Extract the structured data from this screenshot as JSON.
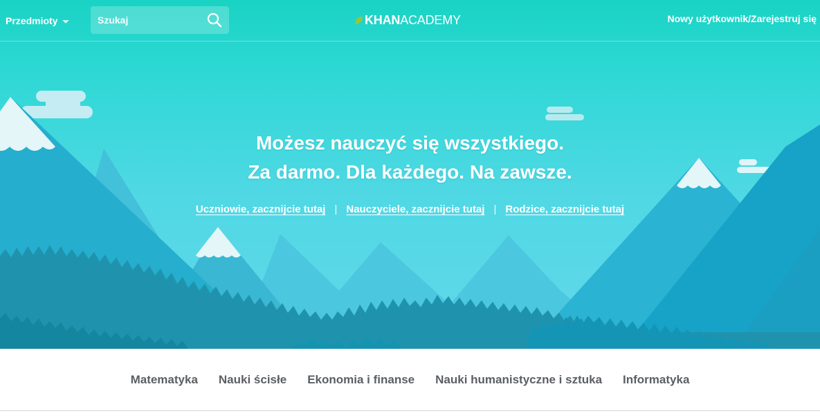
{
  "colors": {
    "hero_top": "#19d3c3",
    "hero_bottom": "#63d7ea",
    "nav_text": "#5b5e63",
    "logo_leaf": "#9cc33b"
  },
  "header": {
    "subjects_label": "Przedmioty",
    "search": {
      "placeholder": "Szukaj",
      "value": "",
      "icon": "search-icon"
    },
    "logo": {
      "khan": "KHAN",
      "academy": "ACADEMY",
      "icon": "leaf-icon"
    },
    "signup_label": "Nowy użytkownik/Zarejestruj się"
  },
  "hero": {
    "headline_line1": "Możesz nauczyć się wszystkiego.",
    "headline_line2": "Za darmo. Dla każdego. Na zawsze.",
    "links": [
      {
        "label": "Uczniowie, zacznijcie tutaj"
      },
      {
        "label": "Nauczyciele, zacznijcie tutaj"
      },
      {
        "label": "Rodzice, zacznijcie tutaj"
      }
    ],
    "separator": "|"
  },
  "subjects_nav": [
    {
      "label": "Matematyka"
    },
    {
      "label": "Nauki ścisłe"
    },
    {
      "label": "Ekonomia i finanse"
    },
    {
      "label": "Nauki humanistyczne i sztuka"
    },
    {
      "label": "Informatyka"
    }
  ]
}
